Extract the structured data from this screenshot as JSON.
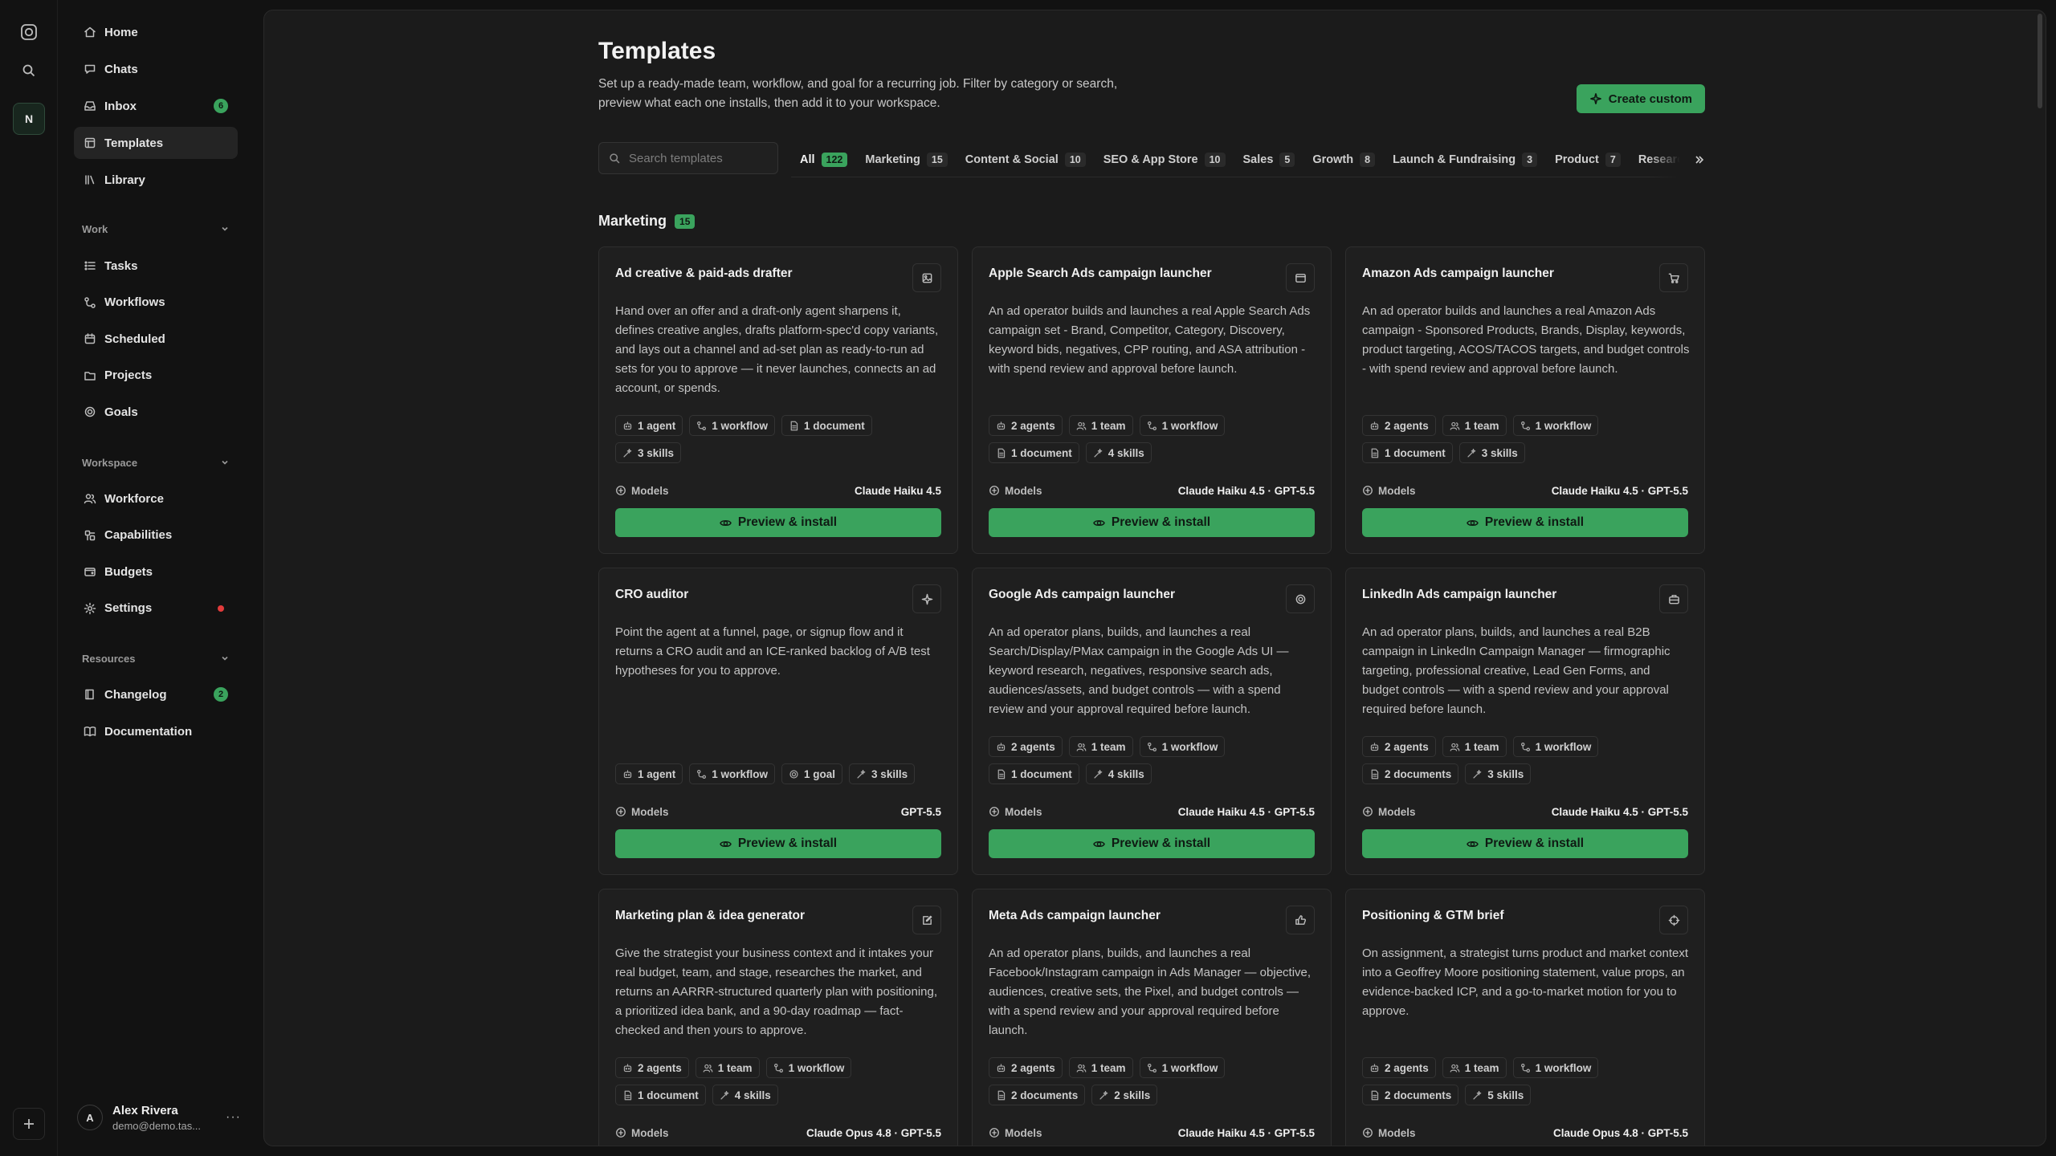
{
  "rail": {
    "workspace_initial": "N"
  },
  "sidebar": {
    "top_items": [
      {
        "label": "Home",
        "icon": "home-icon"
      },
      {
        "label": "Chats",
        "icon": "chat-icon"
      },
      {
        "label": "Inbox",
        "icon": "inbox-icon",
        "badge": "6"
      },
      {
        "label": "Templates",
        "icon": "templates-icon",
        "active": true
      },
      {
        "label": "Library",
        "icon": "library-icon"
      }
    ],
    "work": {
      "title": "Work",
      "items": [
        {
          "label": "Tasks",
          "icon": "tasks-icon"
        },
        {
          "label": "Workflows",
          "icon": "workflow-icon"
        },
        {
          "label": "Scheduled",
          "icon": "calendar-icon"
        },
        {
          "label": "Projects",
          "icon": "folder-icon"
        },
        {
          "label": "Goals",
          "icon": "target-icon"
        }
      ]
    },
    "workspace": {
      "title": "Workspace",
      "items": [
        {
          "label": "Workforce",
          "icon": "users-icon"
        },
        {
          "label": "Capabilities",
          "icon": "capabilities-icon"
        },
        {
          "label": "Budgets",
          "icon": "wallet-icon"
        },
        {
          "label": "Settings",
          "icon": "gear-icon",
          "dot": true
        }
      ]
    },
    "resources": {
      "title": "Resources",
      "items": [
        {
          "label": "Changelog",
          "icon": "book-icon",
          "badge": "2"
        },
        {
          "label": "Documentation",
          "icon": "docs-icon"
        }
      ]
    },
    "user": {
      "initial": "A",
      "name": "Alex Rivera",
      "email": "demo@demo.tas..."
    }
  },
  "page": {
    "title": "Templates",
    "description": "Set up a ready-made team, workflow, and goal for a recurring job. Filter by category or search, preview what each one installs, then add it to your workspace.",
    "create_label": "Create custom",
    "search_placeholder": "Search templates",
    "tabs": [
      {
        "label": "All",
        "count": "122",
        "active": true
      },
      {
        "label": "Marketing",
        "count": "15"
      },
      {
        "label": "Content & Social",
        "count": "10"
      },
      {
        "label": "SEO & App Store",
        "count": "10"
      },
      {
        "label": "Sales",
        "count": "5"
      },
      {
        "label": "Growth",
        "count": "8"
      },
      {
        "label": "Launch & Fundraising",
        "count": "3"
      },
      {
        "label": "Product",
        "count": "7"
      },
      {
        "label": "Research",
        "count": ""
      }
    ],
    "section": {
      "title": "Marketing",
      "count": "15"
    },
    "models_label": "Models",
    "install_label": "Preview & install"
  },
  "cards": [
    {
      "title": "Ad creative & paid-ads drafter",
      "icon": "image-icon",
      "description": "Hand over an offer and a draft-only agent sharpens it, defines creative angles, drafts platform-spec'd copy variants, and lays out a channel and ad-set plan as ready-to-run ad sets for you to approve — it never launches, connects an ad account, or spends.",
      "chips": [
        {
          "icon": "agent-icon",
          "label": "1 agent"
        },
        {
          "icon": "workflow-icon",
          "label": "1 workflow"
        },
        {
          "icon": "document-icon",
          "label": "1 document"
        },
        {
          "icon": "skills-icon",
          "label": "3 skills"
        }
      ],
      "models": "Claude Haiku 4.5"
    },
    {
      "title": "Apple Search Ads campaign launcher",
      "icon": "browser-icon",
      "description": "An ad operator builds and launches a real Apple Search Ads campaign set - Brand, Competitor, Category, Discovery, keyword bids, negatives, CPP routing, and ASA attribution - with spend review and approval before launch.",
      "chips": [
        {
          "icon": "agent-icon",
          "label": "2 agents"
        },
        {
          "icon": "users-icon",
          "label": "1 team"
        },
        {
          "icon": "workflow-icon",
          "label": "1 workflow"
        },
        {
          "icon": "document-icon",
          "label": "1 document"
        },
        {
          "icon": "skills-icon",
          "label": "4 skills"
        }
      ],
      "models": "Claude Haiku 4.5 · GPT-5.5"
    },
    {
      "title": "Amazon Ads campaign launcher",
      "icon": "cart-icon",
      "description": "An ad operator builds and launches a real Amazon Ads campaign - Sponsored Products, Brands, Display, keywords, product targeting, ACOS/TACOS targets, and budget controls - with spend review and approval before launch.",
      "chips": [
        {
          "icon": "agent-icon",
          "label": "2 agents"
        },
        {
          "icon": "users-icon",
          "label": "1 team"
        },
        {
          "icon": "workflow-icon",
          "label": "1 workflow"
        },
        {
          "icon": "document-icon",
          "label": "1 document"
        },
        {
          "icon": "skills-icon",
          "label": "3 skills"
        }
      ],
      "models": "Claude Haiku 4.5 · GPT-5.5"
    },
    {
      "title": "CRO auditor",
      "icon": "sparkle-icon",
      "description": "Point the agent at a funnel, page, or signup flow and it returns a CRO audit and an ICE-ranked backlog of A/B test hypotheses for you to approve.",
      "chips": [
        {
          "icon": "agent-icon",
          "label": "1 agent"
        },
        {
          "icon": "workflow-icon",
          "label": "1 workflow"
        },
        {
          "icon": "target-icon",
          "label": "1 goal"
        },
        {
          "icon": "skills-icon",
          "label": "3 skills"
        }
      ],
      "models": "GPT-5.5"
    },
    {
      "title": "Google Ads campaign launcher",
      "icon": "target-icon",
      "description": "An ad operator plans, builds, and launches a real Search/Display/PMax campaign in the Google Ads UI — keyword research, negatives, responsive search ads, audiences/assets, and budget controls — with a spend review and your approval required before launch.",
      "chips": [
        {
          "icon": "agent-icon",
          "label": "2 agents"
        },
        {
          "icon": "users-icon",
          "label": "1 team"
        },
        {
          "icon": "workflow-icon",
          "label": "1 workflow"
        },
        {
          "icon": "document-icon",
          "label": "1 document"
        },
        {
          "icon": "skills-icon",
          "label": "4 skills"
        }
      ],
      "models": "Claude Haiku 4.5 · GPT-5.5"
    },
    {
      "title": "LinkedIn Ads campaign launcher",
      "icon": "briefcase-icon",
      "description": "An ad operator plans, builds, and launches a real B2B campaign in LinkedIn Campaign Manager — firmographic targeting, professional creative, Lead Gen Forms, and budget controls — with a spend review and your approval required before launch.",
      "chips": [
        {
          "icon": "agent-icon",
          "label": "2 agents"
        },
        {
          "icon": "users-icon",
          "label": "1 team"
        },
        {
          "icon": "workflow-icon",
          "label": "1 workflow"
        },
        {
          "icon": "document-icon",
          "label": "2 documents"
        },
        {
          "icon": "skills-icon",
          "label": "3 skills"
        }
      ],
      "models": "Claude Haiku 4.5 · GPT-5.5"
    },
    {
      "title": "Marketing plan & idea generator",
      "icon": "edit-icon",
      "description": "Give the strategist your business context and it intakes your real budget, team, and stage, researches the market, and returns an AARRR-structured quarterly plan with positioning, a prioritized idea bank, and a 90-day roadmap — fact-checked and then yours to approve.",
      "chips": [
        {
          "icon": "agent-icon",
          "label": "2 agents"
        },
        {
          "icon": "users-icon",
          "label": "1 team"
        },
        {
          "icon": "workflow-icon",
          "label": "1 workflow"
        },
        {
          "icon": "document-icon",
          "label": "1 document"
        },
        {
          "icon": "skills-icon",
          "label": "4 skills"
        }
      ],
      "models": "Claude Opus 4.8 · GPT-5.5"
    },
    {
      "title": "Meta Ads campaign launcher",
      "icon": "thumbs-up-icon",
      "description": "An ad operator plans, builds, and launches a real Facebook/Instagram campaign in Ads Manager — objective, audiences, creative sets, the Pixel, and budget controls — with a spend review and your approval required before launch.",
      "chips": [
        {
          "icon": "agent-icon",
          "label": "2 agents"
        },
        {
          "icon": "users-icon",
          "label": "1 team"
        },
        {
          "icon": "workflow-icon",
          "label": "1 workflow"
        },
        {
          "icon": "document-icon",
          "label": "2 documents"
        },
        {
          "icon": "skills-icon",
          "label": "2 skills"
        }
      ],
      "models": "Claude Haiku 4.5 · GPT-5.5"
    },
    {
      "title": "Positioning & GTM brief",
      "icon": "crosshair-icon",
      "description": "On assignment, a strategist turns product and market context into a Geoffrey Moore positioning statement, value props, an evidence-backed ICP, and a go-to-market motion for you to approve.",
      "chips": [
        {
          "icon": "agent-icon",
          "label": "2 agents"
        },
        {
          "icon": "users-icon",
          "label": "1 team"
        },
        {
          "icon": "workflow-icon",
          "label": "1 workflow"
        },
        {
          "icon": "document-icon",
          "label": "2 documents"
        },
        {
          "icon": "skills-icon",
          "label": "5 skills"
        }
      ],
      "models": "Claude Opus 4.8 · GPT-5.5"
    }
  ]
}
